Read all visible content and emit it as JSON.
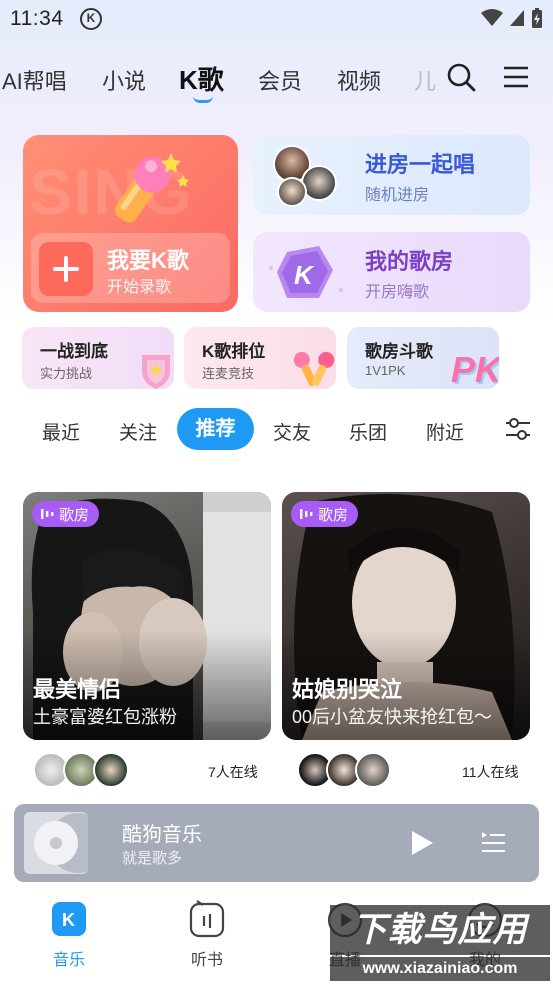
{
  "status_bar": {
    "time": "11:34",
    "k_glyph": "K"
  },
  "top_nav": {
    "tabs": [
      {
        "label": "AI帮唱"
      },
      {
        "label": "小说"
      },
      {
        "label": "K歌"
      },
      {
        "label": "会员"
      },
      {
        "label": "视频"
      },
      {
        "label": "儿"
      }
    ],
    "active_tab": "K歌"
  },
  "feature_cards": {
    "sing": {
      "bg_text": "SING",
      "title": "我要K歌",
      "desc": "开始录歌"
    },
    "join_room": {
      "title": "进房一起唱",
      "desc": "随机进房"
    },
    "my_room": {
      "title": "我的歌房",
      "desc": "开房嗨歌",
      "badge": "K"
    }
  },
  "mini_cards": [
    {
      "title": "一战到底",
      "desc": "实力挑战"
    },
    {
      "title": "K歌排位",
      "desc": "连麦竞技"
    },
    {
      "title": "歌房斗歌",
      "desc": "1V1PK",
      "art": "PK"
    }
  ],
  "filter_tabs": [
    {
      "label": "最近"
    },
    {
      "label": "关注"
    },
    {
      "label": "推荐"
    },
    {
      "label": "交友"
    },
    {
      "label": "乐团"
    },
    {
      "label": "附近"
    }
  ],
  "rooms": [
    {
      "badge": "歌房",
      "title": "最美情侣",
      "desc": "土豪富婆红包涨粉",
      "online": "7人在线"
    },
    {
      "badge": "歌房",
      "title": "姑娘别哭泣",
      "desc": "00后小盆友快来抢红包～",
      "online": "11人在线"
    }
  ],
  "player": {
    "title": "酷狗音乐",
    "subtitle": "就是歌多"
  },
  "bottom_nav": [
    {
      "label": "音乐",
      "icon": "k-icon",
      "active": true
    },
    {
      "label": "听书",
      "icon": "radio-icon",
      "active": false
    },
    {
      "label": "直播",
      "icon": "live-icon",
      "active": false
    },
    {
      "label": "我的",
      "icon": "profile-icon",
      "active": false
    }
  ],
  "watermark": {
    "main": "下载鸟应用",
    "url": "www.xiazainiao.com"
  },
  "colors": {
    "accent": "#1e9af5",
    "sing_card": "#fb6a63",
    "room_badge": "#a65cf5"
  }
}
